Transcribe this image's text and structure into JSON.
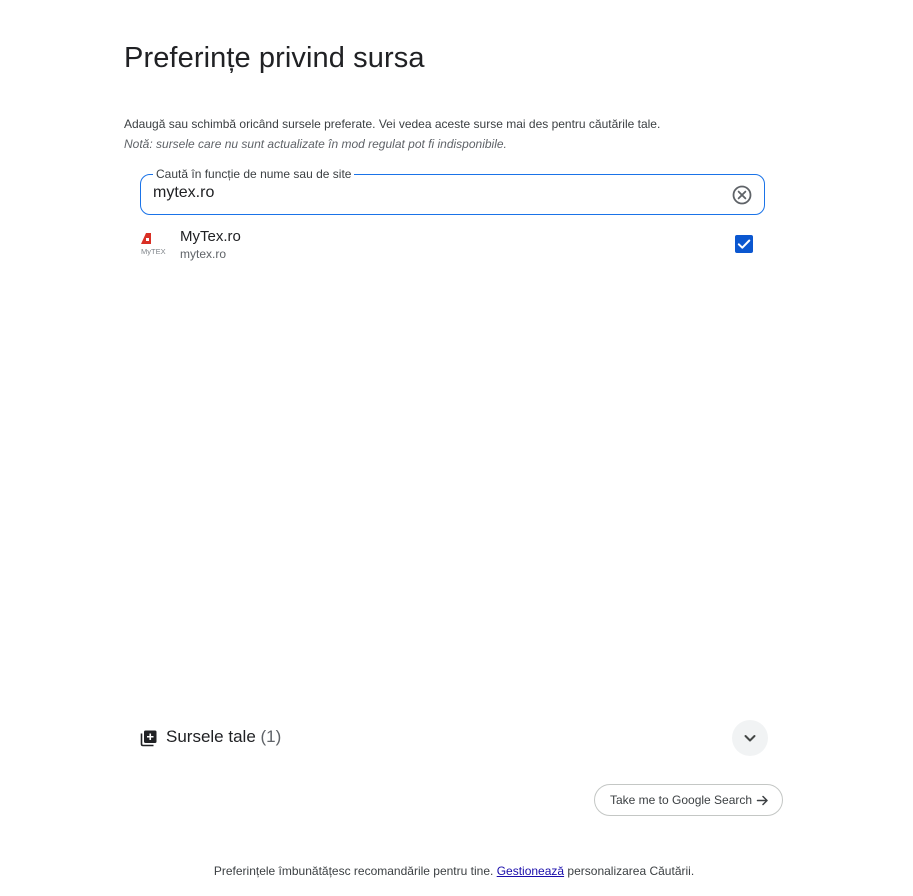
{
  "page": {
    "title": "Preferințe privind sursa",
    "description": "Adaugă sau schimbă oricând sursele preferate. Vei vedea aceste surse mai des pentru căutările tale.",
    "note": "Notă: sursele care nu sunt actualizate în mod regulat pot fi indisponibile."
  },
  "search": {
    "label": "Caută în funcție de nume sau de site",
    "value": "mytex.ro",
    "clear_icon": "close-circle-icon"
  },
  "results": [
    {
      "name": "MyTex.ro",
      "domain": "mytex.ro",
      "logo_text": "MyTEX",
      "checked": true
    }
  ],
  "sources": {
    "title": "Sursele tale",
    "count": "(1)",
    "icon": "add-library-icon",
    "expand_icon": "chevron-down-icon"
  },
  "actions": {
    "go_label": "Take me to Google Search",
    "go_icon": "arrow-right-icon"
  },
  "footer": {
    "text_before": "Preferințele îmbunătățesc recomandările pentru tine.",
    "link": "Gestionează",
    "text_after": "personalizarea Căutării."
  },
  "colors": {
    "accent": "#1a73e8",
    "checkbox": "#0b57d0",
    "logo_red": "#d93025",
    "link": "#1a0dab"
  }
}
